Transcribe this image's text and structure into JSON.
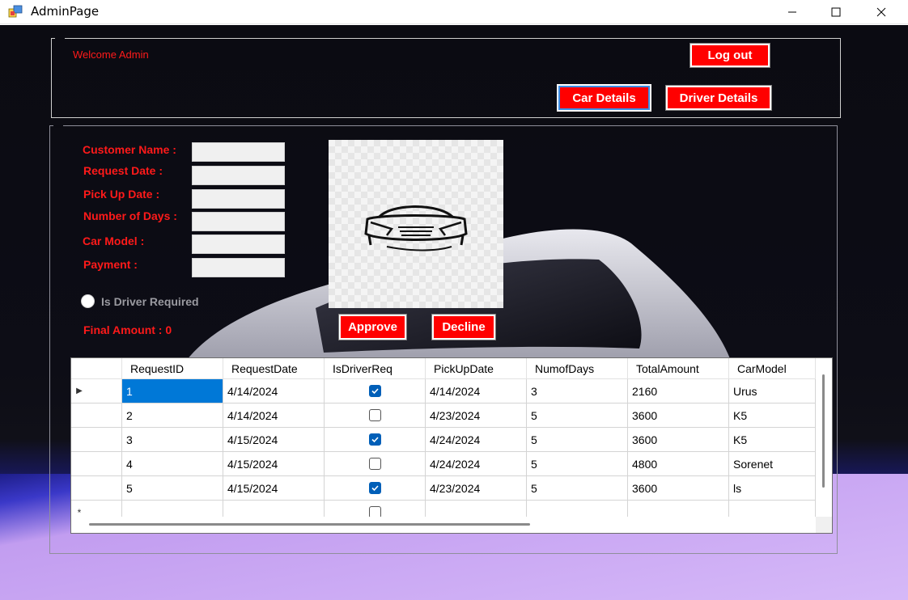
{
  "window": {
    "title": "AdminPage",
    "controls": [
      "minimize-icon",
      "maximize-icon",
      "close-icon"
    ]
  },
  "header": {
    "welcome": "Welcome Admin",
    "logout_label": "Log out",
    "car_details_label": "Car Details",
    "driver_details_label": "Driver Details"
  },
  "form": {
    "customer_name_label": "Customer Name :",
    "request_date_label": "Request Date :",
    "pickup_date_label": "Pick Up Date :",
    "num_days_label": "Number of Days :",
    "car_model_label": "Car Model :",
    "payment_label": "Payment :",
    "customer_name_value": "",
    "request_date_value": "",
    "pickup_date_value": "",
    "num_days_value": "",
    "car_model_value": "",
    "payment_value": "",
    "driver_required_label": "Is Driver Required",
    "final_amount": "Final Amount : 0",
    "approve_label": "Approve",
    "decline_label": "Decline",
    "picture_icon": "car-outline-icon"
  },
  "grid": {
    "columns": [
      "RequestID",
      "RequestDate",
      "IsDriverReq",
      "PickUpDate",
      "NumofDays",
      "TotalAmount",
      "CarModel"
    ],
    "rows": [
      {
        "id": "1",
        "request_date": "4/14/2024",
        "driver": true,
        "pickup": "4/14/2024",
        "days": "3",
        "total": "2160",
        "model": "Urus"
      },
      {
        "id": "2",
        "request_date": "4/14/2024",
        "driver": false,
        "pickup": "4/23/2024",
        "days": "5",
        "total": "3600",
        "model": "K5"
      },
      {
        "id": "3",
        "request_date": "4/15/2024",
        "driver": true,
        "pickup": "4/24/2024",
        "days": "5",
        "total": "3600",
        "model": "K5"
      },
      {
        "id": "4",
        "request_date": "4/15/2024",
        "driver": false,
        "pickup": "4/24/2024",
        "days": "5",
        "total": "4800",
        "model": "Sorenet"
      },
      {
        "id": "5",
        "request_date": "4/15/2024",
        "driver": true,
        "pickup": "4/23/2024",
        "days": "5",
        "total": "3600",
        "model": "ls"
      }
    ],
    "current_row_marker": "▶",
    "new_row_marker": "*",
    "colors": {
      "selection": "#0078d7",
      "checkbox_checked": "#005fb8"
    }
  },
  "theme": {
    "accent_red": "#ff0000",
    "label_red": "#ff1a1a"
  }
}
